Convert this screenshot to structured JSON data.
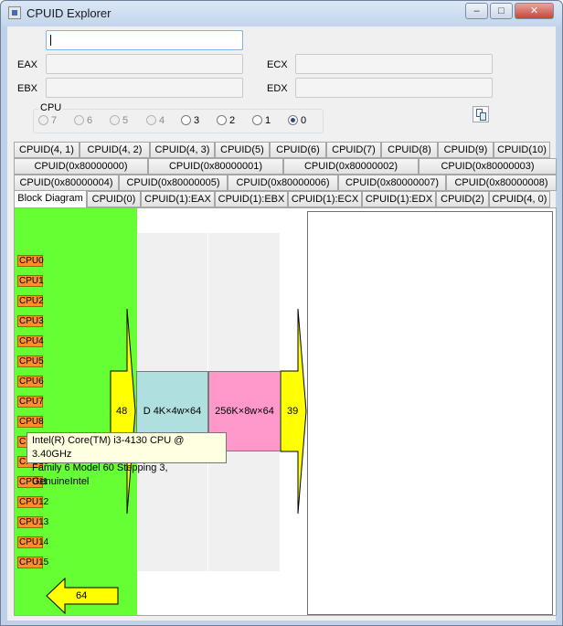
{
  "window": {
    "title": "CPUID Explorer",
    "controls": [
      "–",
      "□",
      "✕"
    ]
  },
  "fields": {
    "top_value": "",
    "eax_label": "EAX",
    "eax_value": "",
    "ebx_label": "EBX",
    "ebx_value": "",
    "ecx_label": "ECX",
    "ecx_value": "",
    "edx_label": "EDX",
    "edx_value": ""
  },
  "cpu_group": {
    "label": "CPU",
    "options": [
      "7",
      "6",
      "5",
      "4",
      "3",
      "2",
      "1",
      "0"
    ],
    "enabled": [
      "3",
      "2",
      "1",
      "0"
    ],
    "selected": "0"
  },
  "copy_button": {
    "icon": "copy-icon"
  },
  "tabs": {
    "row1": [
      "CPUID(4, 1)",
      "CPUID(4, 2)",
      "CPUID(4, 3)",
      "CPUID(5)",
      "CPUID(6)",
      "CPUID(7)",
      "CPUID(8)",
      "CPUID(9)",
      "CPUID(10)"
    ],
    "row2": [
      "CPUID(0x80000000)",
      "CPUID(0x80000001)",
      "CPUID(0x80000002)",
      "CPUID(0x80000003)"
    ],
    "row3": [
      "CPUID(0x80000004)",
      "CPUID(0x80000005)",
      "CPUID(0x80000006)",
      "CPUID(0x80000007)",
      "CPUID(0x80000008)"
    ],
    "row4": [
      "Block Diagram",
      "CPUID(0)",
      "CPUID(1):EAX",
      "CPUID(1):EBX",
      "CPUID(1):ECX",
      "CPUID(1):EDX",
      "CPUID(2)",
      "CPUID(4, 0)"
    ],
    "active": "Block Diagram"
  },
  "diagram": {
    "cpus": [
      "CPU0",
      "CPU1",
      "CPU2",
      "CPU3",
      "CPU4",
      "CPU5",
      "CPU6",
      "CPU7",
      "CPU8",
      "CPU9",
      "CPU10",
      "CPU11",
      "CPU12",
      "CPU13",
      "CPU14",
      "CPU15"
    ],
    "left_bus": "48",
    "l1_cache": "D 4K×4w×64",
    "l2_cache": "256K×8w×64",
    "right_bus": "39",
    "bottom_bus": "64",
    "colors": {
      "cpu_block": "#66ff33",
      "cpu_label": "#ff8c2d",
      "l1": "#b0dfe0",
      "l2": "#ff99cc",
      "bus": "#ffff00"
    }
  },
  "tooltip": {
    "line1": "Intel(R) Core(TM) i3-4130 CPU @ 3.40GHz",
    "line2": "Family 6 Model 60 Stepping 3, GenuineIntel"
  }
}
